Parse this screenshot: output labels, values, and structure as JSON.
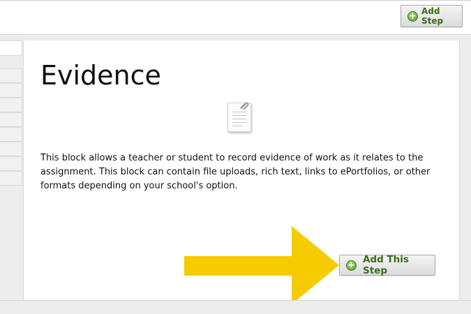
{
  "header": {
    "add_step_label": "Add Step"
  },
  "block": {
    "title": "Evidence",
    "description": "This block allows a teacher or student to record evidence of work as it relates to the assignment. This block can contain file uploads, rich text, links to ePortfolios, or other formats depending on your school's option.",
    "add_this_step_label": "Add This Step",
    "icon": "document-paperclip-icon"
  },
  "icons": {
    "plus": "+"
  },
  "colors": {
    "button_text": "#3d6b1c",
    "plus_icon": "#4f9a2c",
    "arrow": "#f5cc00"
  }
}
